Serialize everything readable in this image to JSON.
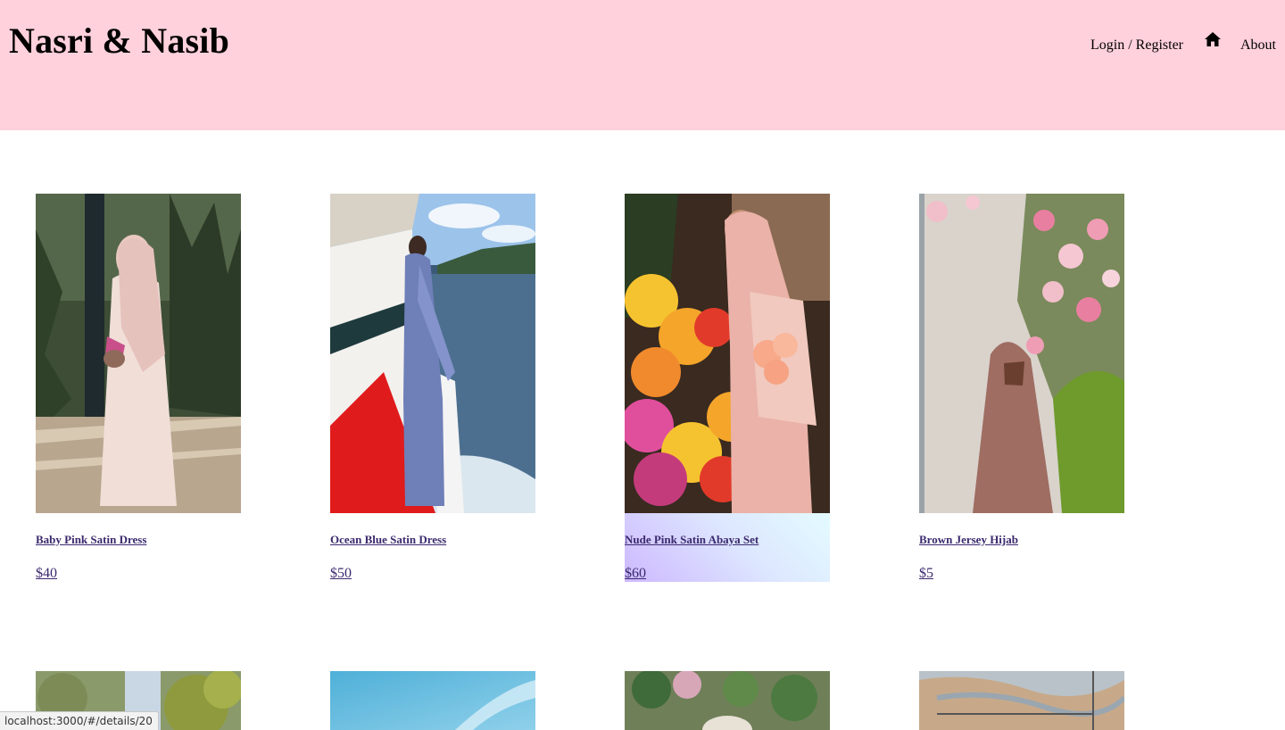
{
  "brand": {
    "title": "Nasri & Nasib"
  },
  "nav": {
    "login": "Login / Register",
    "home_icon": "home-icon",
    "about": "About"
  },
  "products": [
    {
      "name": "Baby Pink Satin Dress",
      "price": "$40"
    },
    {
      "name": "Ocean Blue Satin Dress",
      "price": "$50"
    },
    {
      "name": "Nude Pink Satin Abaya Set",
      "price": "$60"
    },
    {
      "name": "Brown Jersey Hijab",
      "price": "$5"
    }
  ],
  "status_bar": {
    "url": "localhost:3000/#/details/20"
  },
  "colors": {
    "header_bg": "#ffd1dc",
    "link": "#3b2a6e"
  }
}
